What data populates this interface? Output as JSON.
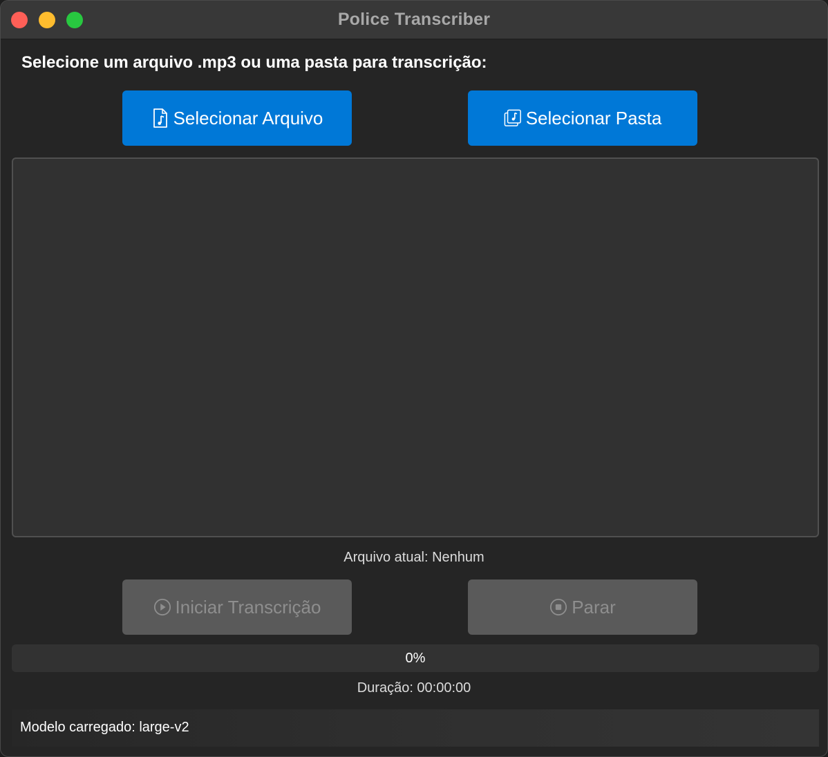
{
  "window": {
    "title": "Police Transcriber"
  },
  "header": {
    "prompt": "Selecione um arquivo .mp3 ou uma pasta para transcrição:"
  },
  "select_buttons": {
    "file_label": "Selecionar Arquivo",
    "file_icon": "music-file-icon",
    "folder_label": "Selecionar Pasta",
    "folder_icon": "music-folder-icon"
  },
  "file_list": {
    "items": []
  },
  "current_file": {
    "text": "Arquivo atual: Nenhum"
  },
  "action_buttons": {
    "start_label": "Iniciar Transcrição",
    "start_icon": "play-circle-icon",
    "start_enabled": false,
    "stop_label": "Parar",
    "stop_icon": "stop-circle-icon",
    "stop_enabled": false
  },
  "progress": {
    "value": 0,
    "label": "0%"
  },
  "duration": {
    "text": "Duração: 00:00:00"
  },
  "status": {
    "text": "Modelo carregado: large-v2"
  },
  "colors": {
    "accent": "#0078d7",
    "disabled": "#5a5a5a",
    "background": "#252525",
    "close": "#fe5f57",
    "minimize": "#febc2e",
    "maximize": "#28c840"
  }
}
